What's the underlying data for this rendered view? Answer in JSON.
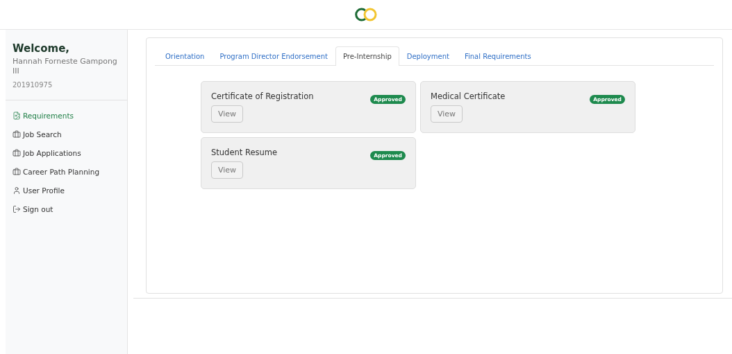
{
  "sidebar": {
    "welcome": "Welcome,",
    "user_name": "Hannah Forneste Gampong III",
    "student_id": "201910975",
    "items": [
      {
        "label": "Requirements",
        "selected": true
      },
      {
        "label": "Job Search",
        "selected": false
      },
      {
        "label": "Job Applications",
        "selected": false
      },
      {
        "label": "Career Path Planning",
        "selected": false
      },
      {
        "label": "User Profile",
        "selected": false
      },
      {
        "label": "Sign out",
        "selected": false
      }
    ]
  },
  "tabs": [
    {
      "label": "Orientation",
      "selected": false
    },
    {
      "label": "Program Director Endorsement",
      "selected": false
    },
    {
      "label": "Pre-Internship",
      "selected": true
    },
    {
      "label": "Deployment",
      "selected": false
    },
    {
      "label": "Final Requirements",
      "selected": false
    }
  ],
  "requirements": [
    {
      "title": "Certificate of Registration",
      "status": "Approved",
      "button": "View"
    },
    {
      "title": "Medical Certificate",
      "status": "Approved",
      "button": "View"
    },
    {
      "title": "Student Resume",
      "status": "Approved",
      "button": "View"
    }
  ]
}
